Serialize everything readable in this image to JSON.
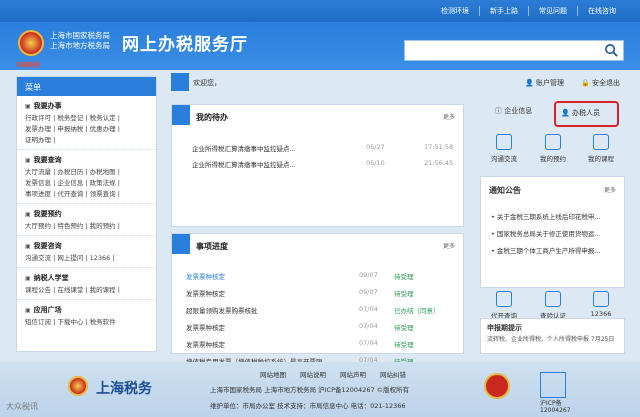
{
  "topnav": {
    "links": [
      "检测环境",
      "新手上路",
      "常见问题",
      "在线咨询"
    ]
  },
  "header": {
    "org_line1": "上海市国家税务局",
    "org_line2": "上海市地方税务局",
    "title": "网上办税服务厅",
    "red_logo": "中国税务",
    "search_placeholder": ""
  },
  "sidebar": {
    "head": "菜单",
    "sections": [
      {
        "title": "我要办事",
        "lines": [
          "行政许可 | 税务登记 | 税务认定 |",
          "发票办理 | 申报纳税 | 优惠办理 |",
          "证明办理 |"
        ]
      },
      {
        "title": "我要查询",
        "lines": [
          "大厅流量 | 办税日历 | 办税地图 |",
          "发票信息 | 企业信息 | 政策法规 |",
          "事项进度 | 代开查询 | 领票查询 |"
        ]
      },
      {
        "title": "我要预约",
        "lines": [
          "大厅预约 | 特色预约 | 我的预约 |"
        ]
      },
      {
        "title": "我要咨询",
        "lines": [
          "沟通交流 | 网上提问 | 12366 |"
        ]
      },
      {
        "title": "纳税人学堂",
        "lines": [
          "课程公告 | 在线课堂 | 我的课程 |"
        ]
      },
      {
        "title": "应用广场",
        "lines": [
          "短信订阅 | 下载中心 | 税务软件"
        ]
      }
    ]
  },
  "welcome": {
    "text": "欢迎您，",
    "account": "账户管理",
    "security": "安全退出"
  },
  "todo": {
    "title": "我的待办",
    "more": "更多",
    "items": [
      {
        "text": "企业所得税汇算清缴事中监控疑点...",
        "date": "05/27",
        "time": "17:51:58"
      },
      {
        "text": "企业所得税汇算清缴事中监控疑点...",
        "date": "05/10",
        "time": "21:56:45"
      }
    ]
  },
  "progress": {
    "title": "事项进度",
    "more": "更多",
    "items": [
      {
        "text": "发票票种核定",
        "date": "09/07",
        "status": "待受理"
      },
      {
        "text": "发票票种核定",
        "date": "09/07",
        "status": "待受理"
      },
      {
        "text": "超限量领购发票购票核批",
        "date": "07/04",
        "status": "已办结（同意）"
      },
      {
        "text": "发票票种核定",
        "date": "07/04",
        "status": "待受理"
      },
      {
        "text": "发票票种核定",
        "date": "07/04",
        "status": "待受理"
      },
      {
        "text": "增值税专用发票（增值税税控系统）最高开票限...",
        "date": "07/04",
        "status": "待受理"
      }
    ]
  },
  "roles": {
    "enterprise": "企业信息",
    "taxpayer": "办税人员"
  },
  "quick": [
    "沟通交流",
    "我的预约",
    "我的课程"
  ],
  "notice": {
    "title": "通知公告",
    "more": "更多",
    "items": [
      "关于金税三期系统上线后印花税申...",
      "国家税务总局关于修正使用货物运...",
      "金税三期个体工商户生产所得申报..."
    ]
  },
  "services": [
    "代开查询",
    "查验认证",
    "12366"
  ],
  "declaration": {
    "title": "申报期提示",
    "text": "流转税、企业所得税、个人所得税申报 7月25日"
  },
  "footer": {
    "links": [
      "网站地图",
      "网站说明",
      "网站声明",
      "网站纠错"
    ],
    "line1": "上海市国家税务局 上海市地方税务局 沪ICP备12004267 ©版权所有",
    "line2": "维护单位：市局办公室   技术支持：市局信息中心 电话：021-12366",
    "brand": "上海税务",
    "badge2": "沪ICP备\n12004267",
    "watermark": "大众税讯"
  }
}
